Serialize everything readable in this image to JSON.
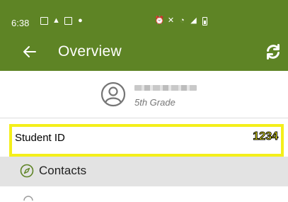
{
  "status_bar": {
    "time": "6:38",
    "icons": [
      "grid-app-icon",
      "drive-icon",
      "image-icon",
      "location-pin-icon",
      "alarm-icon",
      "mute-icon",
      "wifi-icon",
      "signal-icon",
      "battery-icon"
    ]
  },
  "app_bar": {
    "title": "Overview",
    "back_icon": "arrow-left-icon",
    "refresh_icon": "refresh-icon"
  },
  "profile": {
    "grade": "5th Grade"
  },
  "student_id": {
    "label": "Student ID",
    "value": "1234"
  },
  "sections": [
    {
      "label": "Contacts",
      "icon": "compass-icon"
    }
  ],
  "colors": {
    "app_bar": "#5e8425",
    "highlight": "#f4ef1a",
    "section_bg": "#e3e3e3"
  }
}
